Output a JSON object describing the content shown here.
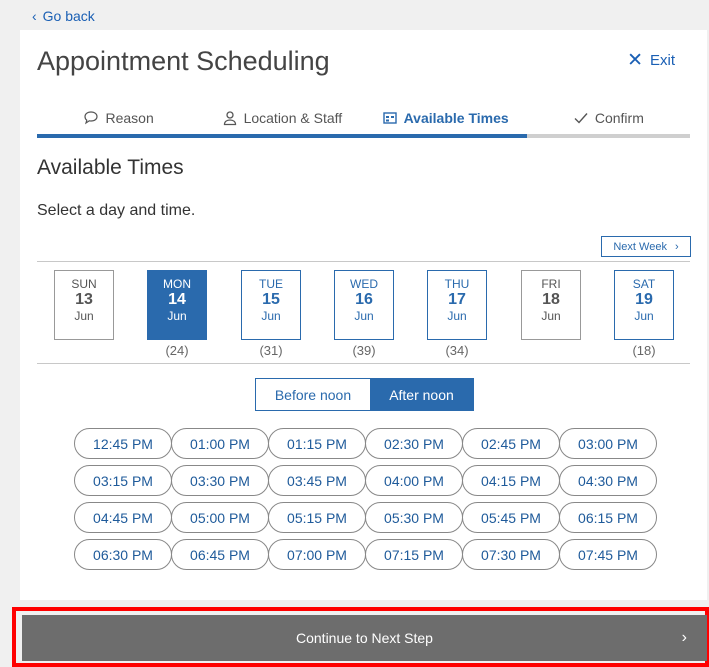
{
  "back": {
    "label": "Go back",
    "icon": "chevron-left-icon"
  },
  "header": {
    "title": "Appointment Scheduling",
    "exit_label": "Exit"
  },
  "steps": [
    {
      "label": "Reason",
      "icon": "speech-bubble-icon",
      "state": "done"
    },
    {
      "label": "Location & Staff",
      "icon": "person-icon",
      "state": "done"
    },
    {
      "label": "Available Times",
      "icon": "calendar-icon",
      "state": "active"
    },
    {
      "label": "Confirm",
      "icon": "checkmark-icon",
      "state": "pending"
    }
  ],
  "section": {
    "heading": "Available Times",
    "instruction": "Select a day and time."
  },
  "next_week": {
    "label": "Next Week"
  },
  "days": [
    {
      "name": "SUN",
      "date": "13",
      "month": "Jun",
      "count": "",
      "state": "unavailable"
    },
    {
      "name": "MON",
      "date": "14",
      "month": "Jun",
      "count": "(24)",
      "state": "selected"
    },
    {
      "name": "TUE",
      "date": "15",
      "month": "Jun",
      "count": "(31)",
      "state": "available"
    },
    {
      "name": "WED",
      "date": "16",
      "month": "Jun",
      "count": "(39)",
      "state": "available"
    },
    {
      "name": "THU",
      "date": "17",
      "month": "Jun",
      "count": "(34)",
      "state": "available"
    },
    {
      "name": "FRI",
      "date": "18",
      "month": "Jun",
      "count": "",
      "state": "unavailable"
    },
    {
      "name": "SAT",
      "date": "19",
      "month": "Jun",
      "count": "(18)",
      "state": "available"
    }
  ],
  "period_toggle": {
    "before": "Before noon",
    "after": "After noon",
    "selected": "after"
  },
  "time_slots": [
    "12:45 PM",
    "01:00 PM",
    "01:15 PM",
    "02:30 PM",
    "02:45 PM",
    "03:00 PM",
    "03:15 PM",
    "03:30 PM",
    "03:45 PM",
    "04:00 PM",
    "04:15 PM",
    "04:30 PM",
    "04:45 PM",
    "05:00 PM",
    "05:15 PM",
    "05:30 PM",
    "05:45 PM",
    "06:15 PM",
    "06:30 PM",
    "06:45 PM",
    "07:00 PM",
    "07:15 PM",
    "07:30 PM",
    "07:45 PM"
  ],
  "cta": {
    "label": "Continue to Next Step"
  },
  "colors": {
    "accent": "#2a6aad",
    "cta_bg": "#6d6d6d",
    "highlight": "#ff0000"
  }
}
